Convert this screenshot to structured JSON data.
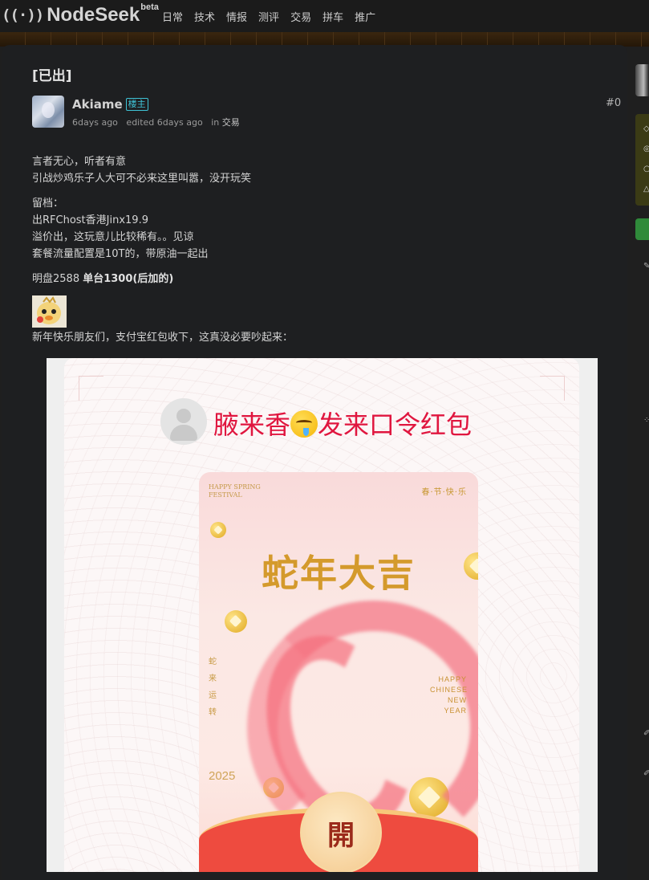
{
  "header": {
    "logo_icon": "((·))",
    "logo_text": "NodeSeek",
    "logo_badge": "beta",
    "nav": [
      "日常",
      "技术",
      "情报",
      "测评",
      "交易",
      "拼车",
      "推广"
    ]
  },
  "post": {
    "title": "[已出]",
    "author": "Akiame",
    "author_badge": "楼主",
    "posted": "6days ago",
    "edited": "edited 6days ago",
    "in_label": "in",
    "category": "交易",
    "floor": "#0",
    "lines": [
      "言者无心，听者有意",
      "引战炒鸡乐子人大可不必来这里叫嚣，没开玩笑",
      "留档：",
      "出RFChost香港Jinx19.9",
      "溢价出，这玩意儿比较稀有。。见谅",
      "套餐流量配置是10T的，带原油一起出"
    ],
    "price_prefix": "明盘2588 ",
    "price_bold": "单台1300(后加的)",
    "sticker_icon": "cartoon-sticker",
    "greeting": "新年快乐朋友们，支付宝红包收下，这真没必要吵起来："
  },
  "image": {
    "sender_text_before": "腋来香",
    "sender_text_after": "发来口令红包",
    "emoji_icon": "drooling-face-emoji",
    "top_left": "HAPPY SPRING FESTIVAL",
    "top_right": "春·节·快·乐",
    "title": "蛇年大吉",
    "vertical": "蛇来运转",
    "year": "2025",
    "happy": "HAPPY CHINESE NEW YEAR",
    "open_label": "開"
  },
  "colors": {
    "page_bg": "#1f1f1f",
    "accent_badge": "#3fc3d6",
    "red_packet_text": "#e0163f",
    "gold": "#d49a2c",
    "packet_red": "#ee4b3f"
  }
}
